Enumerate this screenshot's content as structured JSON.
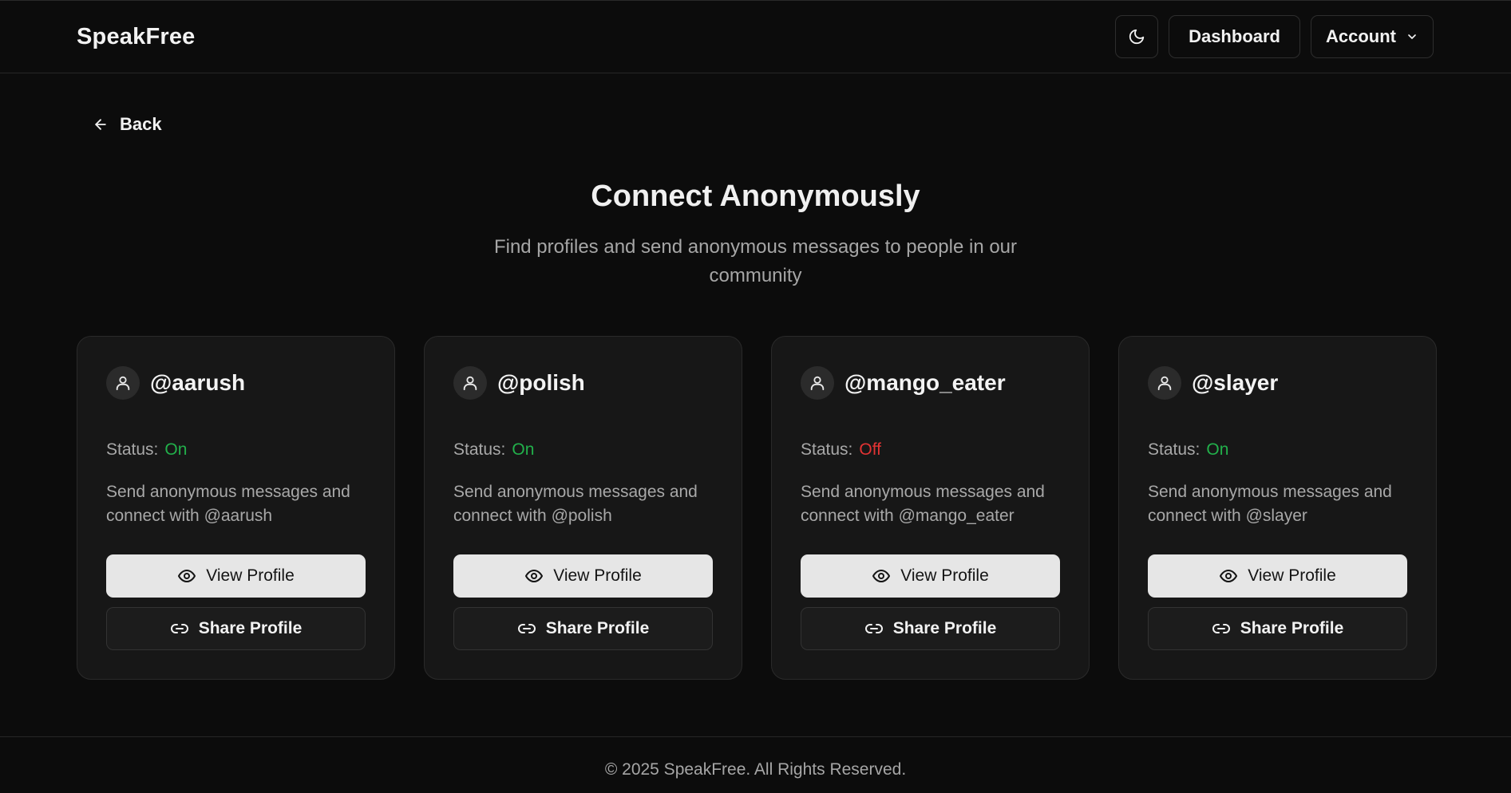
{
  "header": {
    "brand": "SpeakFree",
    "theme_toggle_icon": "moon-icon",
    "dashboard_label": "Dashboard",
    "account_label": "Account"
  },
  "back": {
    "label": "Back"
  },
  "hero": {
    "title": "Connect Anonymously",
    "subtitle": "Find profiles and send anonymous messages to people in our community"
  },
  "profiles": [
    {
      "handle": "@aarush",
      "status_label": "Status:",
      "status": "On",
      "description": "Send anonymous messages and connect with @aarush",
      "view_label": "View Profile",
      "share_label": "Share Profile"
    },
    {
      "handle": "@polish",
      "status_label": "Status:",
      "status": "On",
      "description": "Send anonymous messages and connect with @polish",
      "view_label": "View Profile",
      "share_label": "Share Profile"
    },
    {
      "handle": "@mango_eater",
      "status_label": "Status:",
      "status": "Off",
      "description": "Send anonymous messages and connect with @mango_eater",
      "view_label": "View Profile",
      "share_label": "Share Profile"
    },
    {
      "handle": "@slayer",
      "status_label": "Status:",
      "status": "On",
      "description": "Send anonymous messages and connect with @slayer",
      "view_label": "View Profile",
      "share_label": "Share Profile"
    }
  ],
  "colors": {
    "status_on": "#22b04b",
    "status_off": "#e23333"
  },
  "footer": {
    "copyright": "© 2025 SpeakFree. All Rights Reserved."
  }
}
